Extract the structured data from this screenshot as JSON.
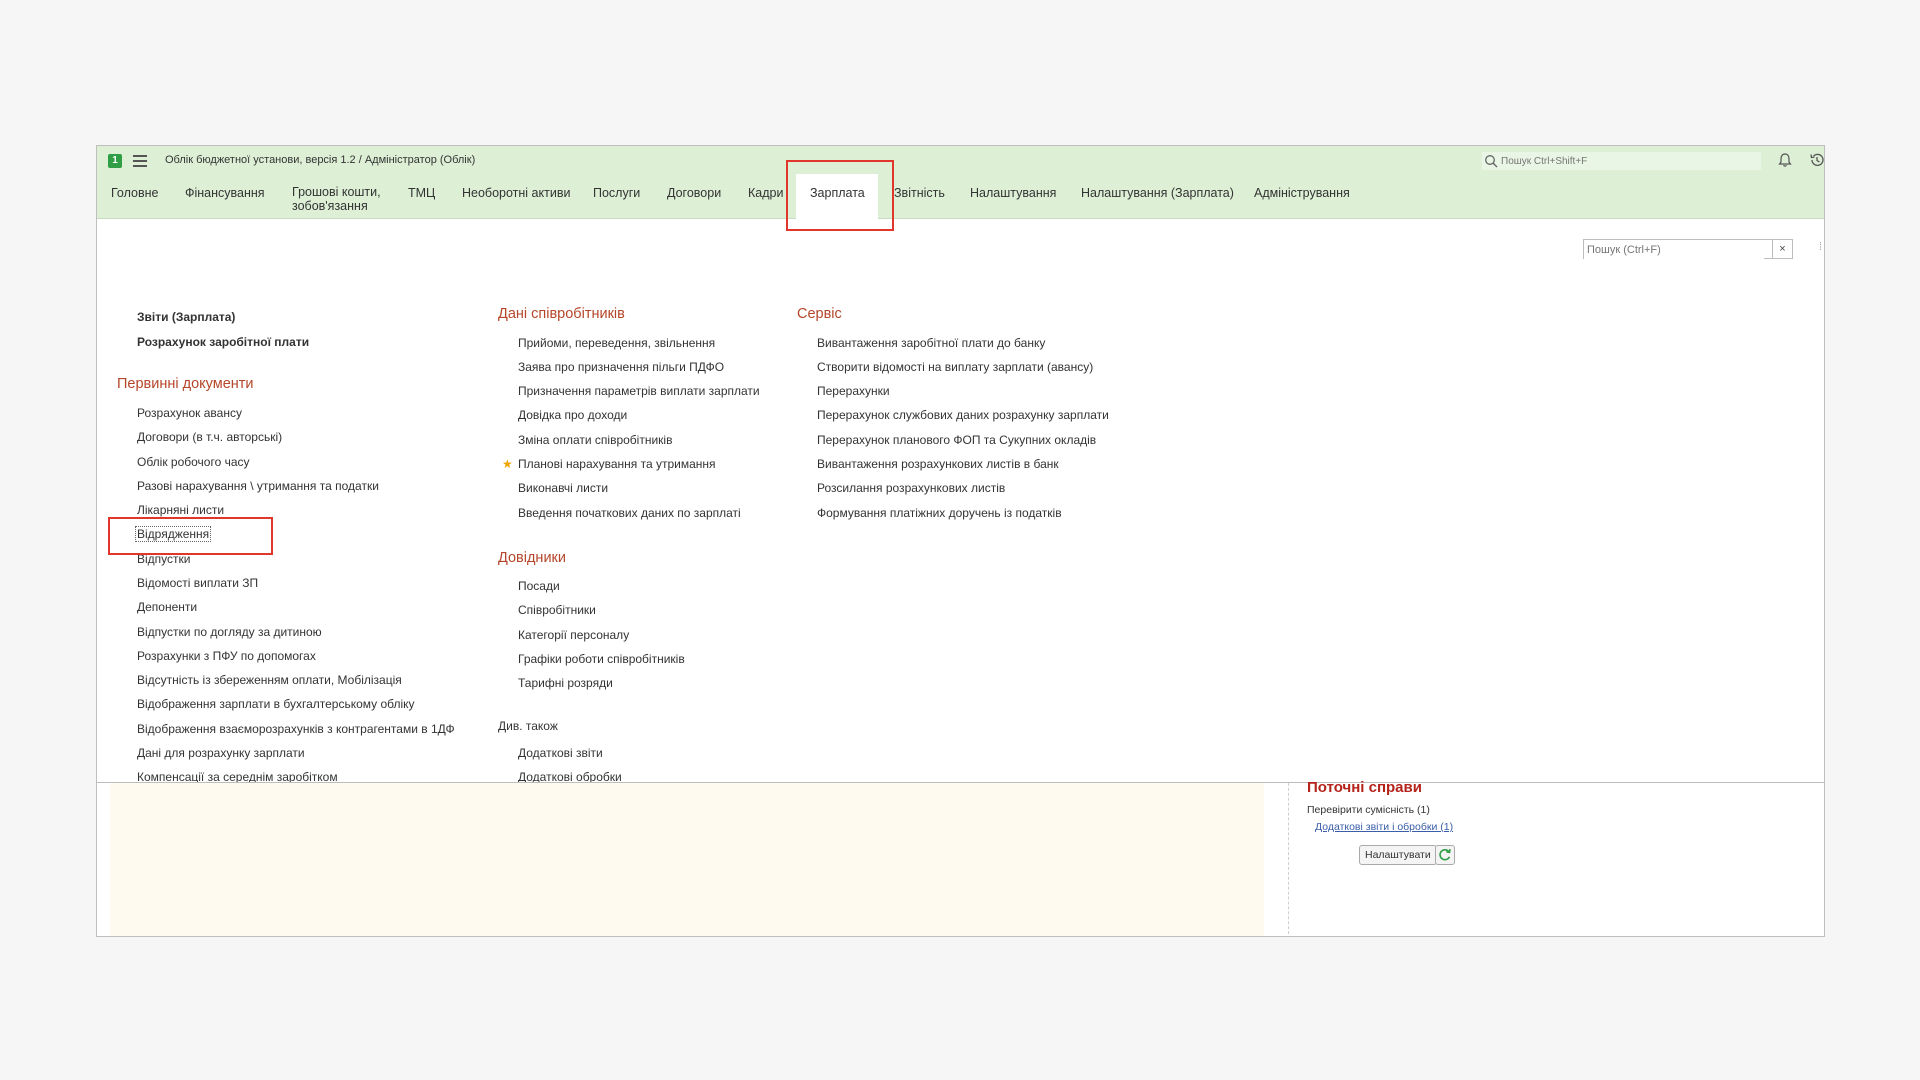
{
  "titlebar": {
    "title": "Облік бюджетної установи, версія 1.2 / Адміністратор  (Облік)",
    "search_placeholder": "Пошук Ctrl+Shift+F"
  },
  "sections": [
    {
      "label": "Головне"
    },
    {
      "label": "Фінансування"
    },
    {
      "label": "Грошові кошти,\nзобов'язання"
    },
    {
      "label": "ТМЦ"
    },
    {
      "label": "Необоротні активи"
    },
    {
      "label": "Послуги"
    },
    {
      "label": "Договори"
    },
    {
      "label": "Кадри"
    },
    {
      "label": "Зарплата",
      "active": true
    },
    {
      "label": "Звітність"
    },
    {
      "label": "Налаштування"
    },
    {
      "label": "Налаштування (Зарплата)"
    },
    {
      "label": "Адміністрування"
    }
  ],
  "content_search": {
    "placeholder": "Пошук (Ctrl+F)",
    "clear": "×"
  },
  "left": {
    "top_links": [
      "Звіти (Зарплата)",
      "Розрахунок заробітної плати"
    ],
    "group_title": "Первинні документи",
    "items": [
      "Розрахунок авансу",
      "Договори (в т.ч. авторські)",
      "Облік робочого часу",
      "Разові нарахування \\ утримання та податки",
      "Лікарняні листи",
      "Відрядження",
      "Відпустки",
      "Відомості виплати ЗП",
      "Депоненти",
      "Відпустки по догляду за дитиною",
      "Розрахунки з ПФУ по допомогах",
      "Відсутність із збереженням оплати, Мобілізація",
      "Відображення зарплати в бухгалтерському обліку",
      "Відображення взаєморозрахунків з контрагентами в 1ДФ",
      "Дані для розрахунку зарплати",
      "Компенсації за середнім заробітком"
    ]
  },
  "middle": {
    "group1_title": "Дані співробітників",
    "group1_items": [
      "Прийоми, переведення, звільнення",
      "Заява про призначення пільги ПДФО",
      "Призначення параметрів виплати зарплати",
      "Довідка про доходи",
      "Зміна оплати співробітників",
      "Планові нарахування та утримання",
      "Виконавчі листи",
      "Введення початкових даних по зарплаті"
    ],
    "group2_title": "Довідники",
    "group2_items": [
      "Посади",
      "Співробітники",
      "Категорії персоналу",
      "Графіки роботи співробітників",
      "Тарифні розряди"
    ],
    "see_also": "Див. також",
    "see_also_items": [
      "Додаткові звіти",
      "Додаткові обробки"
    ]
  },
  "right": {
    "group_title": "Сервіс",
    "items": [
      "Вивантаження заробітної плати до банку",
      "Створити відомості на виплату зарплати (авансу)",
      "Перерахунки",
      "Перерахунок службових даних розрахунку зарплати",
      "Перерахунок планового ФОП та Сукупних окладів",
      "Вивантаження розрахункових листів в банк",
      "Розсилання розрахункових листів",
      "Формування платіжних доручень із податків"
    ]
  },
  "tasks": {
    "title": "Поточні справи",
    "check": "Перевірити сумісність (1)",
    "link": "Додаткові звіти і обробки (1)",
    "settings_button": "Налаштувати"
  }
}
